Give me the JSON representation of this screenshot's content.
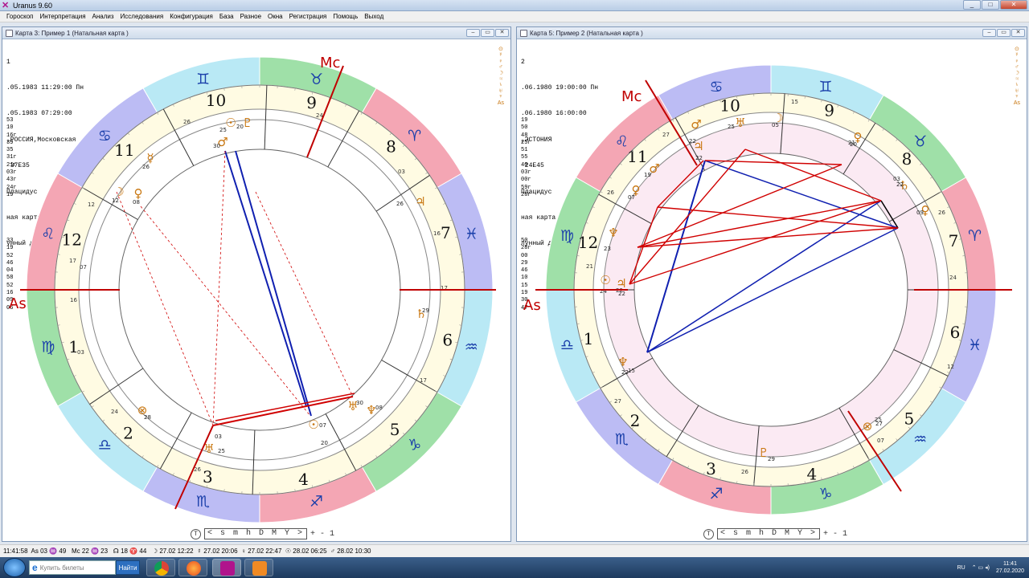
{
  "app": {
    "title": "Uranus  9.60"
  },
  "menu": [
    "Гороскоп",
    "Интерпретация",
    "Анализ",
    "Исследования",
    "Конфигурация",
    "База",
    "Разное",
    "Окна",
    "Регистрация",
    "Помощь",
    "Выход"
  ],
  "windows": [
    {
      "title": "Карта 3: Пример 1   (Натальная карта )",
      "info_lines": [
        "1",
        ".05.1983 11:29:00 Пн",
        ".05.1983 07:29:00",
        ",РОССИЯ,Московская",
        " 37E35",
        "Плацидус",
        "ная карта",
        "унный день"
      ],
      "numbers_top": [
        "53",
        "10",
        "16г",
        "39",
        "35",
        "31г",
        "21г",
        "03г",
        "43г",
        "24г",
        "19"
      ],
      "numbers_bottom": [
        "33",
        "19",
        "52",
        "46",
        "04",
        "58",
        "52",
        "16",
        "09",
        "06"
      ],
      "angle_labels": {
        "asc": "As",
        "mc": "Mc"
      },
      "houses": [
        "1",
        "2",
        "3",
        "4",
        "5",
        "6",
        "7",
        "8",
        "9",
        "10",
        "11",
        "12"
      ],
      "sign_glyphs": [
        "♈",
        "♉",
        "♊",
        "♋",
        "♌",
        "♍",
        "♎",
        "♏",
        "♐",
        "♑",
        "♒",
        "♓"
      ],
      "house_cusp_degrees": [
        "16",
        "03",
        "24",
        "26",
        "17",
        "17",
        "16",
        "03",
        "24",
        "26",
        "12",
        "17",
        "07"
      ],
      "planets": [
        "☉",
        "♀",
        "♂",
        "♃",
        "♄",
        "♅",
        "♆",
        "♇",
        "☽",
        "☿",
        "⊗",
        "♌"
      ],
      "planet_degrees": [
        "25",
        "20",
        "30",
        "26",
        "12",
        "08",
        "26",
        "29",
        "28",
        "30",
        "08",
        "07",
        "03"
      ],
      "timebar": {
        "icon": "T",
        "scale": "<  s m h D M Y  >",
        "step": "+ -    1"
      }
    },
    {
      "title": "Карта 5: Пример 2   (Натальная карта )",
      "info_lines": [
        "2",
        ".06.1980 19:00:00 Пн",
        ".06.1980 16:00:00",
        ",ЭСТОНИЯ",
        " 24E45",
        "Плацидус",
        "ная карта",
        "лунный день"
      ],
      "numbers_top": [
        "19",
        "50",
        "48",
        "25г",
        "51",
        "55",
        "40",
        "03г",
        "00г",
        "59г",
        "28г"
      ],
      "numbers_bottom": [
        "50",
        "28г",
        "00",
        "29",
        "46",
        "10",
        "15",
        "19",
        "30",
        "47"
      ],
      "angle_labels": {
        "asc": "As",
        "mc": "Mc"
      },
      "houses": [
        "1",
        "2",
        "3",
        "4",
        "5",
        "6",
        "7",
        "8",
        "9",
        "10",
        "11",
        "12"
      ],
      "sign_glyphs": [
        "♈",
        "♉",
        "♊",
        "♋",
        "♌",
        "♍",
        "♎",
        "♏",
        "♐",
        "♑",
        "♒",
        "♓"
      ],
      "house_cusp_degrees": [
        "15",
        "27",
        "26",
        "25",
        "12",
        "24",
        "26",
        "03",
        "15",
        "27",
        "26",
        "21",
        "22",
        "05",
        "22",
        "25",
        "07",
        "20",
        "09",
        "19",
        "07",
        "23",
        "24",
        "22",
        "22",
        "29",
        "27"
      ],
      "planets": [
        "☉",
        "♀",
        "♂",
        "♃",
        "♄",
        "♅",
        "♆",
        "♇",
        "☽",
        "☿",
        "⊗",
        "♌"
      ],
      "planet_degrees": [
        "22",
        "22",
        "25",
        "05",
        "21",
        "22",
        "09",
        "19",
        "07",
        "23",
        "24",
        "22",
        "22",
        "29",
        "27",
        "07",
        "20"
      ],
      "timebar": {
        "icon": "T",
        "scale": "<  s m h D M Y  >",
        "step": "+ -    1"
      }
    }
  ],
  "statusbar": "11:41:58  As 03 ♒ 49   Mc 22 ♒ 23   ☊ 18 ♈ 44   ☽ 27.02 12:22  ☿ 27.02 20:06  ♀ 27.02 22:47  ☉ 28.02 06:25  ♂ 28.02 10:30",
  "taskbar": {
    "search_placeholder": "Купить билеты",
    "find_label": "Найти",
    "lang": "RU",
    "time": "11:41",
    "date": "27.02.2020"
  },
  "colors": {
    "accent": "#c00000",
    "aspect_red": "#d00000",
    "aspect_blue": "#1020b0",
    "planet": "#c8760f",
    "sign": "#1a3faa"
  }
}
